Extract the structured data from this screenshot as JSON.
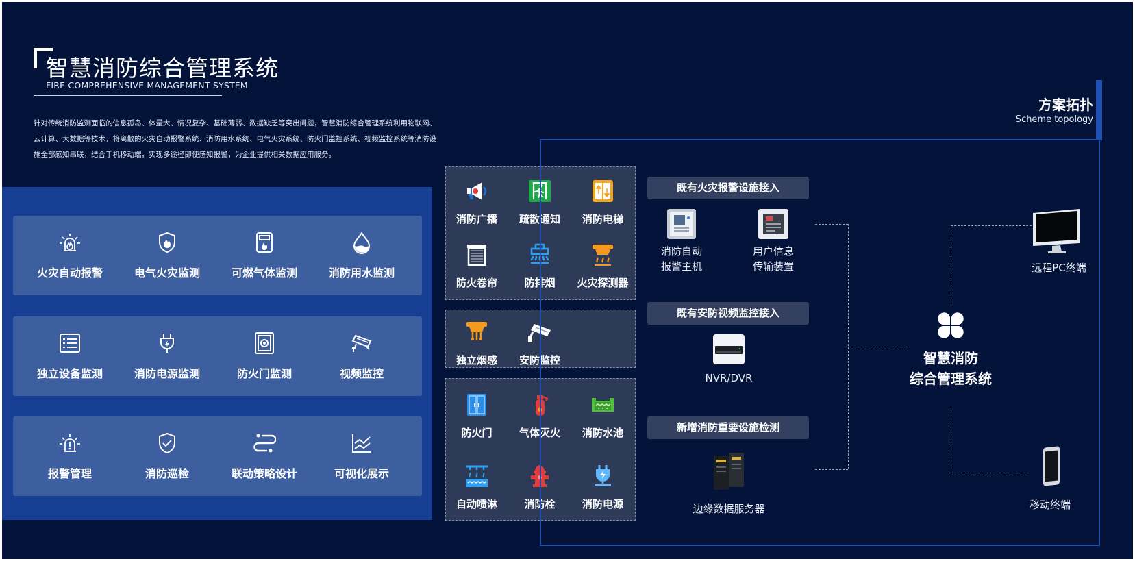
{
  "header": {
    "title_cn": "智慧消防综合管理系统",
    "title_en": "FIRE COMPREHENSIVE MANAGEMENT SYSTEM",
    "description": "针对传统消防监测面临的信息孤岛、体量大、情况复杂、基础薄弱、数据缺乏等突出问题，智慧消防综合管理系统利用物联网、云计算、大数据等技术，将离散的火灾自动报警系统、消防用水系统、电气火灾系统、防火门监控系统、视频监控系统等消防设施全部感知串联，结合手机移动端，实现多途径即使感知报警，为企业提供相关数据应用服务。"
  },
  "features": [
    [
      {
        "label": "火灾自动报警",
        "icon": "fire-alarm-icon"
      },
      {
        "label": "电气火灾监测",
        "icon": "shield-fire-icon"
      },
      {
        "label": "可燃气体监测",
        "icon": "gas-detector-icon"
      },
      {
        "label": "消防用水监测",
        "icon": "water-drop-icon"
      }
    ],
    [
      {
        "label": "独立设备监测",
        "icon": "device-list-icon"
      },
      {
        "label": "消防电源监测",
        "icon": "power-plug-icon"
      },
      {
        "label": "防火门监测",
        "icon": "fire-door-icon"
      },
      {
        "label": "视频监控",
        "icon": "cctv-camera-icon"
      }
    ],
    [
      {
        "label": "报警管理",
        "icon": "alarm-light-icon"
      },
      {
        "label": "消防巡检",
        "icon": "check-shield-icon"
      },
      {
        "label": "联动策略设计",
        "icon": "linkage-icon"
      },
      {
        "label": "可视化展示",
        "icon": "chart-icon"
      }
    ]
  ],
  "device_groups": [
    [
      {
        "label": "消防广播",
        "icon": "megaphone-icon"
      },
      {
        "label": "疏散通知",
        "icon": "exit-sign-icon"
      },
      {
        "label": "消防电梯",
        "icon": "elevator-icon"
      },
      {
        "label": "防火卷帘",
        "icon": "shutter-icon"
      },
      {
        "label": "防排烟",
        "icon": "smoke-exhaust-icon"
      },
      {
        "label": "火灾探测器",
        "icon": "heat-detector-icon"
      }
    ],
    [
      {
        "label": "独立烟感",
        "icon": "smoke-detector-icon"
      },
      {
        "label": "安防监控",
        "icon": "security-camera-icon"
      }
    ],
    [
      {
        "label": "防火门",
        "icon": "door-icon"
      },
      {
        "label": "气体灭火",
        "icon": "extinguisher-icon"
      },
      {
        "label": "消防水池",
        "icon": "water-pool-icon"
      },
      {
        "label": "自动喷淋",
        "icon": "sprinkler-icon"
      },
      {
        "label": "消防栓",
        "icon": "hydrant-icon"
      },
      {
        "label": "消防电源",
        "icon": "power-supply-icon"
      }
    ]
  ],
  "topology": {
    "title": "方案拓扑",
    "subtitle": "Scheme topology",
    "sections": [
      {
        "header": "既有火灾报警设施接入",
        "items": [
          {
            "label": "消防自动\n报警主机",
            "icon": "alarm-host-icon"
          },
          {
            "label": "用户信息\n传输装置",
            "icon": "transmission-device-icon"
          }
        ]
      },
      {
        "header": "既有安防视频监控接入",
        "items": [
          {
            "label": "NVR/DVR",
            "icon": "nvr-icon"
          }
        ]
      },
      {
        "header": "新增消防重要设施检测",
        "items": [
          {
            "label": "边缘数据服务器",
            "icon": "edge-server-icon"
          }
        ]
      }
    ],
    "center": {
      "line1": "智慧消防",
      "line2": "综合管理系统",
      "icon": "clover-logo-icon"
    },
    "terminals": [
      {
        "label": "远程PC终端",
        "icon": "monitor-icon"
      },
      {
        "label": "移动终端",
        "icon": "phone-icon"
      }
    ]
  }
}
